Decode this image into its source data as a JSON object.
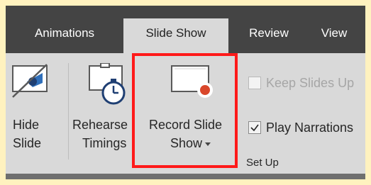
{
  "tabs": [
    {
      "label": "Animations",
      "active": false
    },
    {
      "label": "Slide Show",
      "active": true
    },
    {
      "label": "Review",
      "active": false
    },
    {
      "label": "View",
      "active": false
    }
  ],
  "commands": {
    "hide_slide": {
      "line1": "Hide",
      "line2": "Slide"
    },
    "rehearse_timings": {
      "line1": "Rehearse",
      "line2": "Timings"
    },
    "record_slide_show": {
      "line1": "Record Slide",
      "line2": "Show"
    }
  },
  "options": {
    "keep_slides_updated": {
      "label": "Keep Slides Up",
      "checked": false,
      "enabled": false
    },
    "play_narrations": {
      "label": "Play Narrations",
      "checked": true,
      "enabled": true
    }
  },
  "group": {
    "label": "Set Up"
  },
  "colors": {
    "border_highlight": "#ff1a1a",
    "tab_bar": "#444444",
    "ribbon": "#d9d9d9",
    "record_dot": "#d9472b",
    "accent_blue": "#2f6fba"
  }
}
